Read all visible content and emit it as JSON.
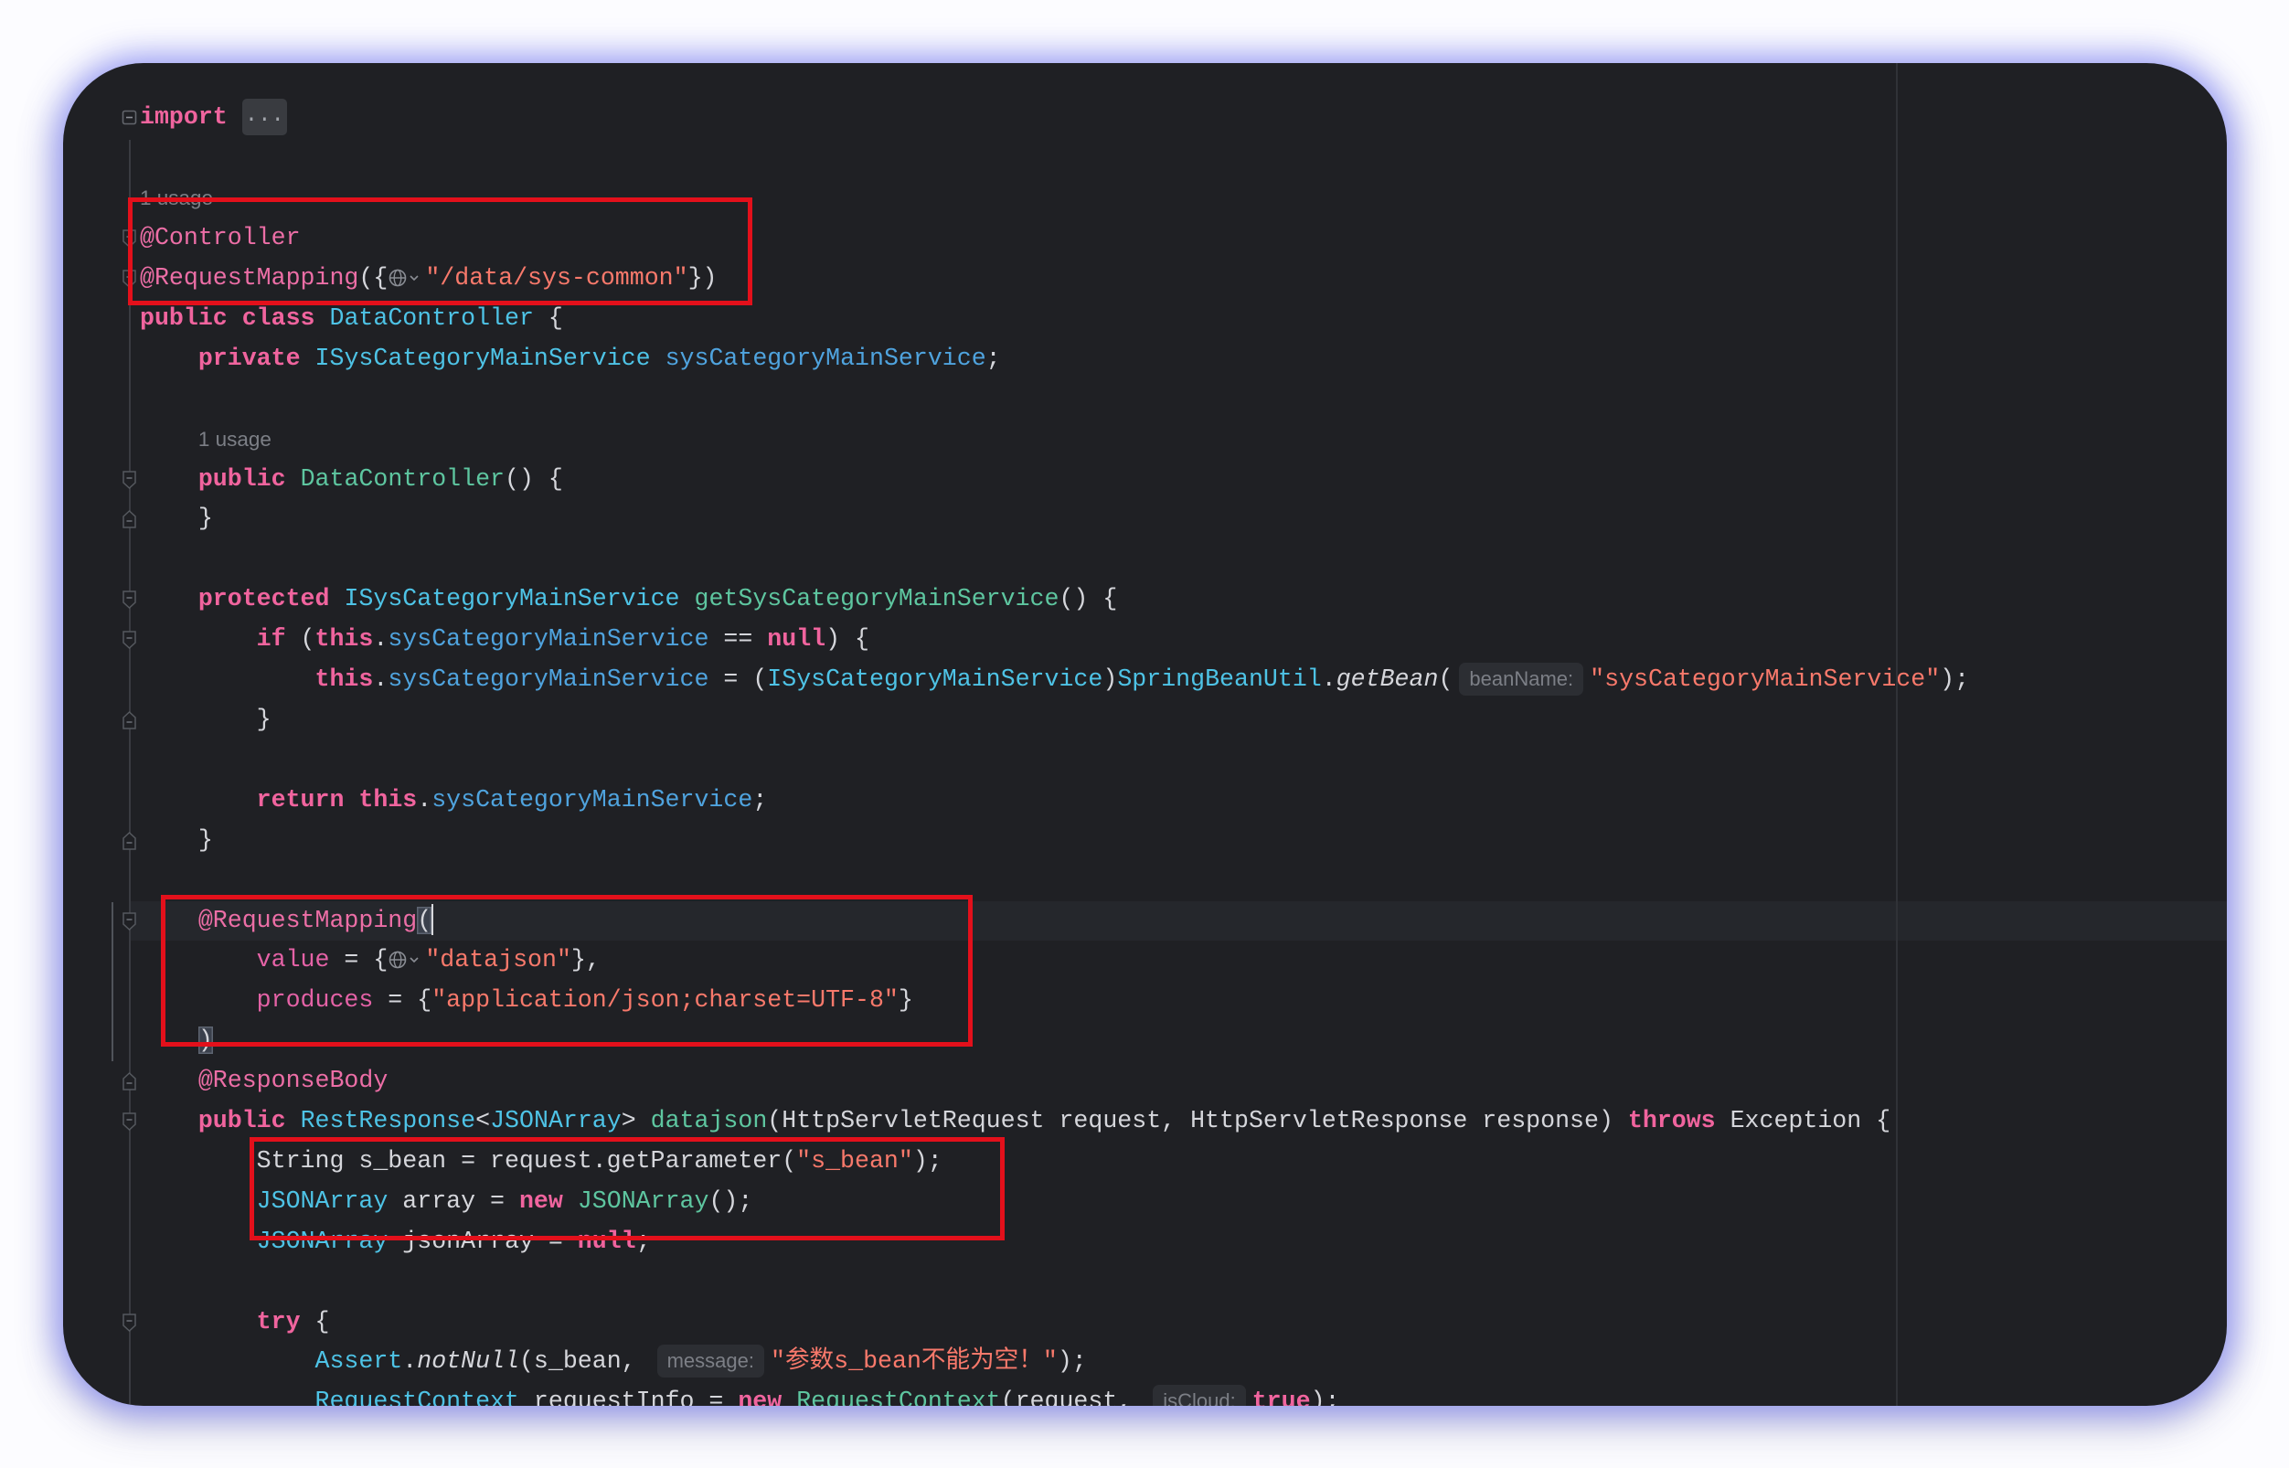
{
  "theme": {
    "background": "#1f2024",
    "current_line": "#25272c",
    "text": "#d5d6db",
    "keyword": "#f0649e",
    "annotation": "#ec6ea6",
    "annotation_attribute": "#e462a6",
    "type": "#4ec3e6",
    "method": "#5ec6a0",
    "field": "#4fa3de",
    "string": "#f8796b",
    "hint_text": "#7c7f86",
    "highlight_box": "#e3101b"
  },
  "editor": {
    "lines": [
      {
        "gutter": "fold-toggle-icon",
        "tokens": [
          {
            "t": "import",
            "c": "kw"
          },
          {
            "t": " ",
            "c": "p"
          },
          {
            "t": "...",
            "c": "collapsed"
          }
        ]
      },
      {
        "tokens": []
      },
      {
        "tokens": [
          {
            "t": "1 usage",
            "c": "usage"
          }
        ]
      },
      {
        "gutter": "fold-start-icon",
        "tokens": [
          {
            "t": "@Controller",
            "c": "ann"
          }
        ]
      },
      {
        "gutter": "fold-start-icon",
        "tokens": [
          {
            "t": "@RequestMapping",
            "c": "ann"
          },
          {
            "t": "({",
            "c": "p"
          },
          {
            "c": "globe",
            "icon": "globe-icon"
          },
          {
            "t": "\"/data/sys-common\"",
            "c": "str"
          },
          {
            "t": "})",
            "c": "p"
          }
        ]
      },
      {
        "tokens": [
          {
            "t": "public class",
            "c": "kw"
          },
          {
            "t": " ",
            "c": "p"
          },
          {
            "t": "DataController",
            "c": "type"
          },
          {
            "t": " {",
            "c": "p"
          }
        ]
      },
      {
        "tokens": [
          {
            "t": "    ",
            "c": "p"
          },
          {
            "t": "private",
            "c": "kw"
          },
          {
            "t": " ",
            "c": "p"
          },
          {
            "t": "ISysCategoryMainService",
            "c": "type"
          },
          {
            "t": " ",
            "c": "p"
          },
          {
            "t": "sysCategoryMainService",
            "c": "field"
          },
          {
            "t": ";",
            "c": "p"
          }
        ]
      },
      {
        "tokens": []
      },
      {
        "tokens": [
          {
            "t": "    ",
            "c": "p"
          },
          {
            "t": "1 usage",
            "c": "usage"
          }
        ]
      },
      {
        "gutter": "fold-start-icon",
        "tokens": [
          {
            "t": "    ",
            "c": "p"
          },
          {
            "t": "public",
            "c": "kw"
          },
          {
            "t": " ",
            "c": "p"
          },
          {
            "t": "DataController",
            "c": "ctor"
          },
          {
            "t": "() {",
            "c": "p"
          }
        ]
      },
      {
        "gutter": "fold-end-icon",
        "tokens": [
          {
            "t": "    }",
            "c": "p"
          }
        ]
      },
      {
        "tokens": []
      },
      {
        "gutter": "fold-start-icon",
        "tokens": [
          {
            "t": "    ",
            "c": "p"
          },
          {
            "t": "protected",
            "c": "kw"
          },
          {
            "t": " ",
            "c": "p"
          },
          {
            "t": "ISysCategoryMainService",
            "c": "type"
          },
          {
            "t": " ",
            "c": "p"
          },
          {
            "t": "getSysCategoryMainService",
            "c": "ctor"
          },
          {
            "t": "() {",
            "c": "p"
          }
        ]
      },
      {
        "gutter": "fold-start-icon",
        "tokens": [
          {
            "t": "        ",
            "c": "p"
          },
          {
            "t": "if",
            "c": "kw"
          },
          {
            "t": " (",
            "c": "p"
          },
          {
            "t": "this",
            "c": "kw"
          },
          {
            "t": ".",
            "c": "p"
          },
          {
            "t": "sysCategoryMainService",
            "c": "field"
          },
          {
            "t": " == ",
            "c": "p"
          },
          {
            "t": "null",
            "c": "kw"
          },
          {
            "t": ") {",
            "c": "p"
          }
        ]
      },
      {
        "tokens": [
          {
            "t": "            ",
            "c": "p"
          },
          {
            "t": "this",
            "c": "kw"
          },
          {
            "t": ".",
            "c": "p"
          },
          {
            "t": "sysCategoryMainService",
            "c": "field"
          },
          {
            "t": " = (",
            "c": "p"
          },
          {
            "t": "ISysCategoryMainService",
            "c": "type"
          },
          {
            "t": ")",
            "c": "p"
          },
          {
            "t": "SpringBeanUtil",
            "c": "type"
          },
          {
            "t": ".",
            "c": "p"
          },
          {
            "t": "getBean",
            "c": "ital"
          },
          {
            "t": "(",
            "c": "p"
          },
          {
            "t": "beanName:",
            "c": "hint"
          },
          {
            "t": "\"sysCategoryMainService\"",
            "c": "str"
          },
          {
            "t": ");",
            "c": "p"
          }
        ]
      },
      {
        "gutter": "fold-end-icon",
        "tokens": [
          {
            "t": "        }",
            "c": "p"
          }
        ]
      },
      {
        "tokens": []
      },
      {
        "tokens": [
          {
            "t": "        ",
            "c": "p"
          },
          {
            "t": "return",
            "c": "kw"
          },
          {
            "t": " ",
            "c": "p"
          },
          {
            "t": "this",
            "c": "kw"
          },
          {
            "t": ".",
            "c": "p"
          },
          {
            "t": "sysCategoryMainService",
            "c": "field"
          },
          {
            "t": ";",
            "c": "p"
          }
        ]
      },
      {
        "gutter": "fold-end-icon",
        "tokens": [
          {
            "t": "    }",
            "c": "p"
          }
        ]
      },
      {
        "tokens": []
      },
      {
        "current": true,
        "gutter": "fold-start-icon",
        "tokens": [
          {
            "t": "    ",
            "c": "p"
          },
          {
            "t": "@RequestMapping",
            "c": "ann"
          },
          {
            "t": "(",
            "c": "brace"
          },
          {
            "c": "caret"
          }
        ]
      },
      {
        "tokens": [
          {
            "t": "        ",
            "c": "p"
          },
          {
            "t": "value",
            "c": "attr"
          },
          {
            "t": " = {",
            "c": "p"
          },
          {
            "c": "globe",
            "icon": "globe-icon"
          },
          {
            "t": "\"datajson\"",
            "c": "str"
          },
          {
            "t": "},",
            "c": "p"
          }
        ]
      },
      {
        "tokens": [
          {
            "t": "        ",
            "c": "p"
          },
          {
            "t": "produces",
            "c": "attr"
          },
          {
            "t": " = {",
            "c": "p"
          },
          {
            "t": "\"application/json;charset=UTF-8\"",
            "c": "str"
          },
          {
            "t": "}",
            "c": "p"
          }
        ]
      },
      {
        "tokens": [
          {
            "t": "    ",
            "c": "p"
          },
          {
            "t": ")",
            "c": "brace"
          }
        ]
      },
      {
        "gutter": "fold-end-icon",
        "tokens": [
          {
            "t": "    ",
            "c": "p"
          },
          {
            "t": "@ResponseBody",
            "c": "ann"
          }
        ]
      },
      {
        "gutter": "fold-start-icon",
        "tokens": [
          {
            "t": "    ",
            "c": "p"
          },
          {
            "t": "public",
            "c": "kw"
          },
          {
            "t": " ",
            "c": "p"
          },
          {
            "t": "RestResponse",
            "c": "type"
          },
          {
            "t": "<",
            "c": "p"
          },
          {
            "t": "JSONArray",
            "c": "type"
          },
          {
            "t": "> ",
            "c": "p"
          },
          {
            "t": "datajson",
            "c": "ctor"
          },
          {
            "t": "(HttpServletRequest request, HttpServletResponse response) ",
            "c": "p"
          },
          {
            "t": "throws",
            "c": "kw"
          },
          {
            "t": " Exception {",
            "c": "p"
          }
        ]
      },
      {
        "tokens": [
          {
            "t": "        String s_bean = request.getParameter(",
            "c": "p"
          },
          {
            "t": "\"s_bean\"",
            "c": "str"
          },
          {
            "t": ");",
            "c": "p"
          }
        ]
      },
      {
        "tokens": [
          {
            "t": "        ",
            "c": "p"
          },
          {
            "t": "JSONArray",
            "c": "type"
          },
          {
            "t": " array = ",
            "c": "p"
          },
          {
            "t": "new",
            "c": "kw"
          },
          {
            "t": " ",
            "c": "p"
          },
          {
            "t": "JSONArray",
            "c": "ctor"
          },
          {
            "t": "();",
            "c": "p"
          }
        ]
      },
      {
        "tokens": [
          {
            "t": "        ",
            "c": "p"
          },
          {
            "t": "JSONArray",
            "c": "type"
          },
          {
            "t": " jsonArray = ",
            "c": "p"
          },
          {
            "t": "null",
            "c": "kw"
          },
          {
            "t": ";",
            "c": "p"
          }
        ]
      },
      {
        "tokens": []
      },
      {
        "gutter": "fold-start-icon",
        "tokens": [
          {
            "t": "        ",
            "c": "p"
          },
          {
            "t": "try",
            "c": "kw"
          },
          {
            "t": " {",
            "c": "p"
          }
        ]
      },
      {
        "tokens": [
          {
            "t": "            ",
            "c": "p"
          },
          {
            "t": "Assert",
            "c": "type"
          },
          {
            "t": ".",
            "c": "p"
          },
          {
            "t": "notNull",
            "c": "ital"
          },
          {
            "t": "(s_bean, ",
            "c": "p"
          },
          {
            "t": "message:",
            "c": "hint"
          },
          {
            "t": "\"参数s_bean不能为空！\"",
            "c": "str"
          },
          {
            "t": ");",
            "c": "p"
          }
        ]
      },
      {
        "tokens": [
          {
            "t": "            ",
            "c": "p"
          },
          {
            "t": "RequestContext",
            "c": "type"
          },
          {
            "t": " requestInfo = ",
            "c": "p"
          },
          {
            "t": "new",
            "c": "kw"
          },
          {
            "t": " ",
            "c": "p"
          },
          {
            "t": "RequestContext",
            "c": "ctor"
          },
          {
            "t": "(request, ",
            "c": "p"
          },
          {
            "t": "isCloud:",
            "c": "hint"
          },
          {
            "t": "true",
            "c": "kw"
          },
          {
            "t": ");",
            "c": "p"
          }
        ]
      }
    ]
  }
}
